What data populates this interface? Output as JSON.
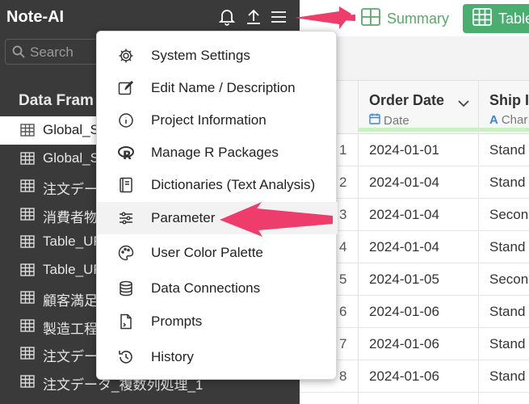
{
  "app": {
    "title": "Note-AI"
  },
  "topbar_icons": [
    "bell-icon",
    "upload-icon",
    "hamburger-menu-icon"
  ],
  "search": {
    "placeholder": "Search"
  },
  "sidebar": {
    "section_title": "Data Fram",
    "items": [
      {
        "label": "Global_S",
        "active": true
      },
      {
        "label": "Global_S",
        "active": false
      },
      {
        "label": "注文デー",
        "active": false
      },
      {
        "label": "消費者物",
        "active": false
      },
      {
        "label": "Table_UF",
        "active": false
      },
      {
        "label": "Table_UF",
        "active": false
      },
      {
        "label": "顧客満足",
        "active": false
      },
      {
        "label": "製造工程",
        "active": false
      },
      {
        "label": "注文デー",
        "active": false
      },
      {
        "label": "注文データ_複数列処理_1",
        "active": false
      }
    ]
  },
  "view_tabs": {
    "summary": "Summary",
    "table": "Table"
  },
  "table": {
    "columns": [
      {
        "name": "Order Date",
        "type": "Date"
      },
      {
        "name": "Ship I",
        "type": "Char"
      }
    ],
    "rows": [
      {
        "num": "1",
        "date": "2024-01-01",
        "ship": "Stand"
      },
      {
        "num": "2",
        "date": "2024-01-04",
        "ship": "Stand"
      },
      {
        "num": "3",
        "date": "2024-01-04",
        "ship": "Secon"
      },
      {
        "num": "4",
        "date": "2024-01-04",
        "ship": "Stand"
      },
      {
        "num": "5",
        "date": "2024-01-05",
        "ship": "Secon"
      },
      {
        "num": "6",
        "date": "2024-01-06",
        "ship": "Stand"
      },
      {
        "num": "7",
        "date": "2024-01-06",
        "ship": "Stand"
      },
      {
        "num": "8",
        "date": "2024-01-06",
        "ship": "Stand"
      }
    ]
  },
  "menu": {
    "items": [
      {
        "label": "System Settings",
        "icon": "gear-icon"
      },
      {
        "label": "Edit Name / Description",
        "icon": "edit-icon"
      },
      {
        "label": "Project Information",
        "icon": "info-icon"
      },
      {
        "label": "Manage R Packages",
        "icon": "r-logo-icon"
      },
      {
        "label": "Dictionaries (Text Analysis)",
        "icon": "book-icon"
      },
      {
        "label": "Parameter",
        "icon": "sliders-icon",
        "highlighted": true
      },
      {
        "label": "User Color Palette",
        "icon": "palette-icon"
      },
      {
        "label": "Data Connections",
        "icon": "database-icon"
      },
      {
        "label": "Prompts",
        "icon": "prompt-file-icon"
      },
      {
        "label": "History",
        "icon": "history-icon"
      }
    ]
  },
  "colors": {
    "sidebar_bg": "#3a3a3a",
    "accent_green": "#4aae70",
    "arrow_pink": "#ee3d6a"
  }
}
